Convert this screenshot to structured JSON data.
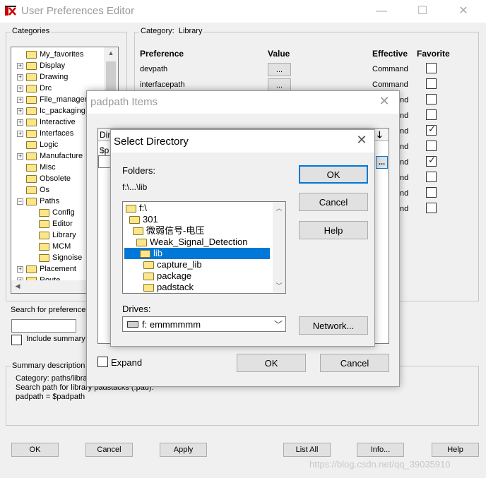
{
  "window": {
    "title": "User Preferences Editor"
  },
  "categories": {
    "label": "Categories",
    "items": [
      {
        "label": "My_favorites",
        "expandable": false,
        "indent": 0
      },
      {
        "label": "Display",
        "expandable": true,
        "indent": 0
      },
      {
        "label": "Drawing",
        "expandable": true,
        "indent": 0
      },
      {
        "label": "Drc",
        "expandable": true,
        "indent": 0
      },
      {
        "label": "File_manager",
        "expandable": true,
        "indent": 0
      },
      {
        "label": "Ic_packaging",
        "expandable": true,
        "indent": 0
      },
      {
        "label": "Interactive",
        "expandable": true,
        "indent": 0
      },
      {
        "label": "Interfaces",
        "expandable": true,
        "indent": 0
      },
      {
        "label": "Logic",
        "expandable": false,
        "indent": 0
      },
      {
        "label": "Manufacture",
        "expandable": true,
        "indent": 0
      },
      {
        "label": "Misc",
        "expandable": false,
        "indent": 0
      },
      {
        "label": "Obsolete",
        "expandable": false,
        "indent": 0
      },
      {
        "label": "Os",
        "expandable": false,
        "indent": 0
      },
      {
        "label": "Paths",
        "expandable": true,
        "expanded": true,
        "indent": 0
      },
      {
        "label": "Config",
        "expandable": false,
        "indent": 1
      },
      {
        "label": "Editor",
        "expandable": false,
        "indent": 1
      },
      {
        "label": "Library",
        "expandable": false,
        "indent": 1
      },
      {
        "label": "MCM",
        "expandable": false,
        "indent": 1
      },
      {
        "label": "Signoise",
        "expandable": false,
        "indent": 1
      },
      {
        "label": "Placement",
        "expandable": true,
        "indent": 0
      },
      {
        "label": "Route",
        "expandable": true,
        "indent": 0
      }
    ]
  },
  "category_panel": {
    "label_prefix": "Category:",
    "category": "Library",
    "headers": {
      "preference": "Preference",
      "value": "Value",
      "effective": "Effective",
      "favorite": "Favorite"
    },
    "rows": [
      {
        "name": "devpath",
        "effective": "Command",
        "favorite": false
      },
      {
        "name": "interfacepath",
        "effective": "Command",
        "favorite": false
      },
      {
        "name": "",
        "effective": "nd",
        "favorite": false
      },
      {
        "name": "",
        "effective": "nd",
        "favorite": false
      },
      {
        "name": "",
        "effective": "nd",
        "favorite": true
      },
      {
        "name": "",
        "effective": "nd",
        "favorite": false
      },
      {
        "name": "",
        "effective": "nd",
        "favorite": true
      },
      {
        "name": "",
        "effective": "nd",
        "favorite": false
      },
      {
        "name": "",
        "effective": "nd",
        "favorite": false
      },
      {
        "name": "",
        "effective": "nd",
        "favorite": false
      }
    ],
    "browse_label": "..."
  },
  "search": {
    "label": "Search for preference:",
    "value": "",
    "include_summary_label": "Include summary i"
  },
  "summary": {
    "label": "Summary description",
    "lines": [
      "Category: paths/librar",
      "Search path for library padstacks (.pad).",
      "padpath = $padpath"
    ]
  },
  "bottom_buttons": {
    "ok": "OK",
    "cancel": "Cancel",
    "apply": "Apply",
    "list_all": "List All",
    "info": "Info...",
    "help": "Help"
  },
  "watermark": "https://blog.csdn.net/qq_39035910",
  "padpath_dialog": {
    "title": "padpath Items",
    "list_header": "Dir",
    "first_item": "$p",
    "expand_label": "Expand",
    "ok": "OK",
    "cancel": "Cancel",
    "browse_label": "..."
  },
  "select_dir": {
    "title": "Select Directory",
    "folders_label": "Folders:",
    "current_path": "f:\\...\\lib",
    "tree": [
      {
        "label": "f:\\",
        "indent": 0,
        "open": true,
        "selected": false
      },
      {
        "label": "301",
        "indent": 1,
        "open": true,
        "selected": false
      },
      {
        "label": "微弱信号-电压",
        "indent": 2,
        "open": true,
        "selected": false
      },
      {
        "label": "Weak_Signal_Detection",
        "indent": 3,
        "open": true,
        "selected": false
      },
      {
        "label": "lib",
        "indent": 4,
        "open": true,
        "selected": true
      },
      {
        "label": "capture_lib",
        "indent": 5,
        "open": false,
        "selected": false
      },
      {
        "label": "package",
        "indent": 5,
        "open": false,
        "selected": false
      },
      {
        "label": "padstack",
        "indent": 5,
        "open": false,
        "selected": false
      }
    ],
    "drives_label": "Drives:",
    "drive_value": "f: emmmmmm",
    "ok": "OK",
    "cancel": "Cancel",
    "help": "Help",
    "network": "Network..."
  },
  "colors": {
    "selection": "#0078d7",
    "folder": "#fce68a"
  }
}
